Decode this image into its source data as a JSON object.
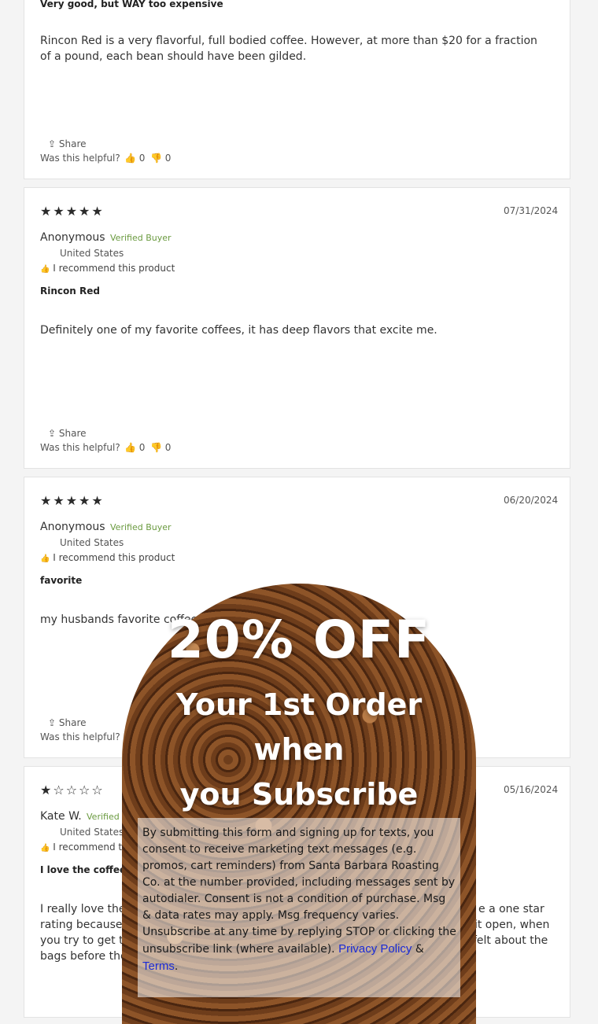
{
  "reviews": [
    {
      "title": "Very good, but WAY too expensive",
      "body": "Rincon Red is a very flavorful, full bodied coffee. However, at more than $20 for a fraction of a pound, each bean should have been gilded.",
      "share": "Share",
      "helpful": "Was this helpful?",
      "up": "0",
      "down": "0"
    },
    {
      "stars": "★★★★★",
      "date": "07/31/2024",
      "name": "Anonymous",
      "verified": "Verified Buyer",
      "location": "United States",
      "recommend": "I recommend this product",
      "title": "Rincon Red",
      "body": "Definitely one of my favorite coffees, it has deep flavors that excite me.",
      "share": "Share",
      "helpful": "Was this helpful?",
      "up": "0",
      "down": "0"
    },
    {
      "stars": "★★★★★",
      "date": "06/20/2024",
      "name": "Anonymous",
      "verified": "Verified Buyer",
      "location": "United States",
      "recommend": "I recommend this product",
      "title": "favorite",
      "body": "my husbands favorite coffee",
      "share": "Share",
      "helpful": "Was this helpful?"
    },
    {
      "stars": "★☆☆☆☆",
      "date": "05/16/2024",
      "name": "Kate W.",
      "verified": "Verified",
      "location": "United States",
      "recommend": "I recommend th",
      "title": "I love the coffee",
      "body_l1a": "I really love the I",
      "body_l1b": "e a one star",
      "body_l2a": "rating because o",
      "body_l2b": "t it open, when",
      "body_l3a": "you try to get th",
      "body_l3b": "felt about the",
      "body_l4a": "bags before they"
    }
  ],
  "popup": {
    "headline": "20% OFF",
    "subhead_line1": "Your 1st Order when",
    "subhead_line2": "you Subscribe",
    "consent": "By submitting this form and signing up for texts, you consent to receive marketing text messages (e.g. promos, cart reminders) from Santa Barbara Roasting Co. at the number provided, including messages sent by autodialer. Consent is not a condition of purchase. Msg & data rates may apply. Msg frequency varies. Unsubscribe at any time by replying STOP or clicking the unsubscribe link (where available).",
    "privacy_link": "Privacy Policy",
    "amp": "&",
    "terms_link": "Terms",
    "period": ".",
    "close_icon": "close-icon"
  }
}
